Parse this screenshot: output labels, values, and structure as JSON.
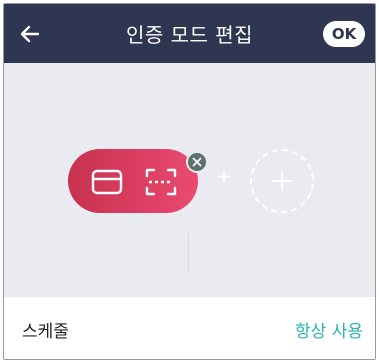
{
  "header": {
    "title": "인증 모드 편집",
    "ok_label": "OK",
    "back_icon": "arrow-left-icon"
  },
  "mode_editor": {
    "selected_mode": {
      "icons": [
        "card-icon",
        "face-scan-icon"
      ],
      "color_start": "#c8314f",
      "color_end": "#ea4a70",
      "remove_icon": "close-icon"
    },
    "separator_icon": "plus-icon",
    "add_icon": "plus-icon",
    "background": "#e9ebf1"
  },
  "schedule": {
    "label": "스케줄",
    "value": "항상 사용",
    "value_color": "#2bb3b0"
  },
  "colors": {
    "header_bg": "#2f3651"
  }
}
